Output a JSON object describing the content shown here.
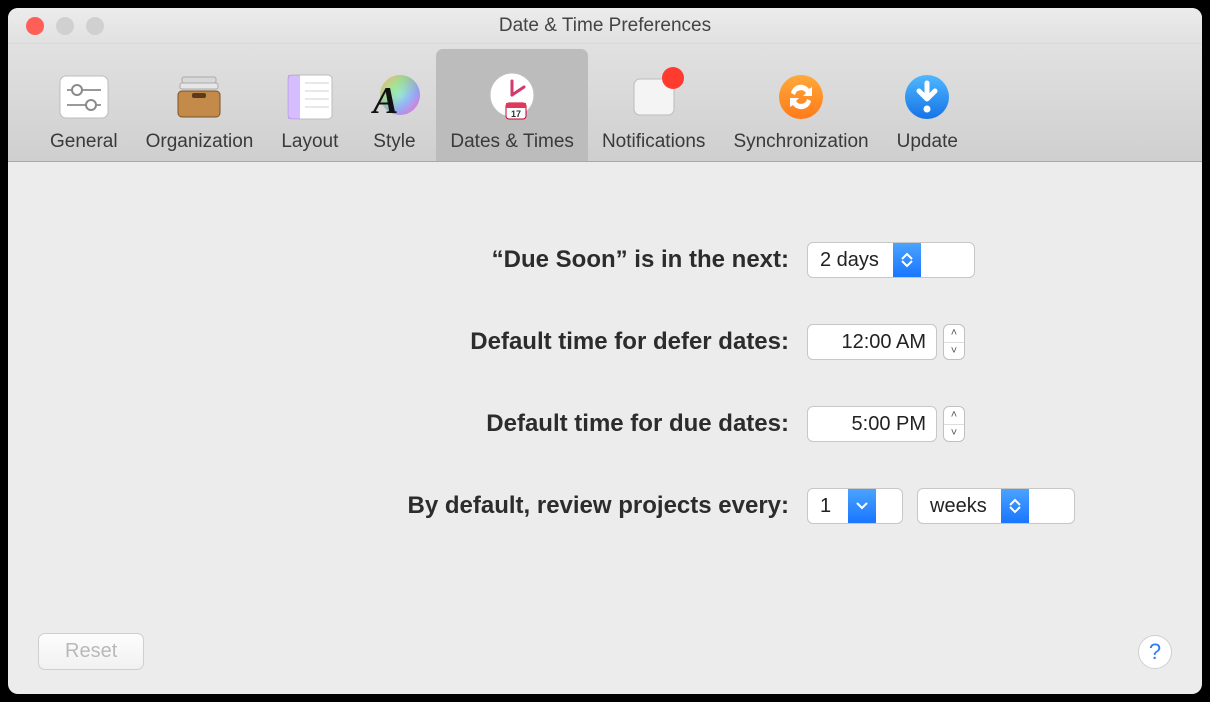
{
  "window": {
    "title": "Date & Time Preferences"
  },
  "toolbar": {
    "tabs": [
      {
        "id": "general",
        "label": "General"
      },
      {
        "id": "organization",
        "label": "Organization"
      },
      {
        "id": "layout",
        "label": "Layout"
      },
      {
        "id": "style",
        "label": "Style"
      },
      {
        "id": "dates-times",
        "label": "Dates & Times",
        "selected": true
      },
      {
        "id": "notifications",
        "label": "Notifications",
        "badge": true
      },
      {
        "id": "sync",
        "label": "Synchronization"
      },
      {
        "id": "update",
        "label": "Update"
      }
    ]
  },
  "form": {
    "due_soon": {
      "label": "“Due Soon” is in the next:",
      "value": "2 days"
    },
    "defer_time": {
      "label": "Default time for defer dates:",
      "value": "12:00 AM"
    },
    "due_time": {
      "label": "Default time for due dates:",
      "value": "5:00 PM"
    },
    "review": {
      "label": "By default, review projects every:",
      "count": "1",
      "unit": "weeks"
    }
  },
  "footer": {
    "reset": "Reset",
    "help_glyph": "?"
  }
}
